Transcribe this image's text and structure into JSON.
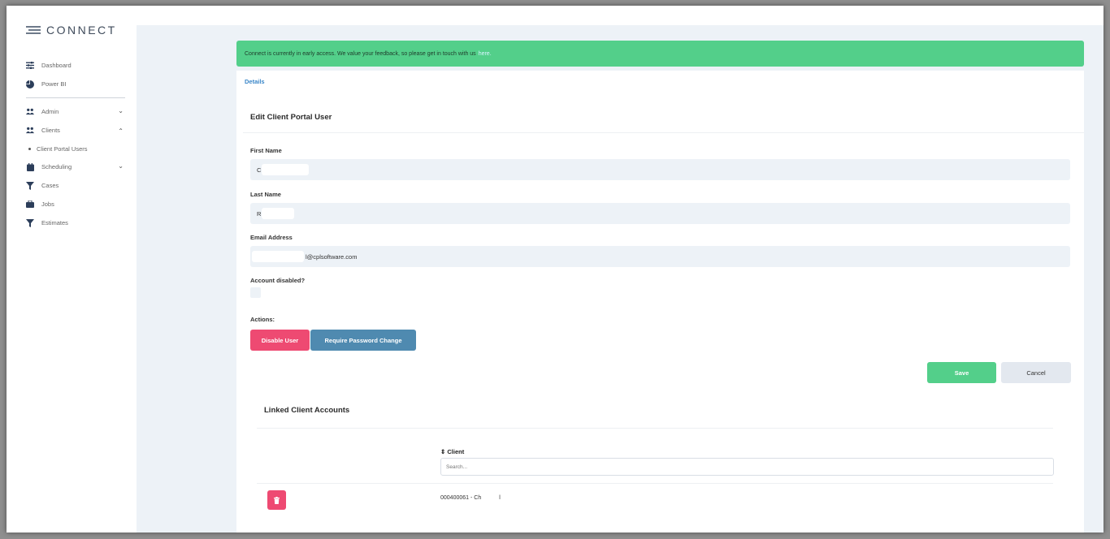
{
  "app": {
    "logo_text": "CONNECT"
  },
  "sidebar": {
    "items": [
      {
        "label": "Dashboard",
        "icon": "sliders-icon"
      },
      {
        "label": "Power BI",
        "icon": "pie-chart-icon"
      },
      {
        "label": "Admin",
        "icon": "users-icon",
        "expanded": false
      },
      {
        "label": "Clients",
        "icon": "users-icon",
        "expanded": true
      },
      {
        "label": "Client Portal Users",
        "sub": true
      },
      {
        "label": "Scheduling",
        "icon": "calendar-icon",
        "expanded": false
      },
      {
        "label": "Cases",
        "icon": "filter-icon"
      },
      {
        "label": "Jobs",
        "icon": "briefcase-icon"
      },
      {
        "label": "Estimates",
        "icon": "filter-icon"
      }
    ]
  },
  "alert": {
    "text": "Connect is currently in early access. We value your feedback, so please get in touch with us",
    "link": "here.",
    "color": "#53cf8a"
  },
  "tabs": {
    "details": "Details"
  },
  "form": {
    "title": "Edit Client Portal User",
    "first_name": {
      "label": "First Name",
      "value": "C"
    },
    "last_name": {
      "label": "Last Name",
      "value": "R"
    },
    "email": {
      "label": "Email Address",
      "value": "l@cplsoftware.com"
    },
    "account_disabled": {
      "label": "Account disabled?",
      "checked": false
    },
    "actions_label": "Actions:",
    "disable_user": "Disable User",
    "require_password": "Require Password Change",
    "save": "Save",
    "cancel": "Cancel"
  },
  "linked": {
    "title": "Linked Client Accounts",
    "column_header": "Client",
    "sort_icon": "⇕",
    "search_placeholder": "Search...",
    "rows": [
      {
        "client": "000400061 - Ch",
        "client_suffix": "l"
      }
    ]
  },
  "colors": {
    "accent_green": "#53cf8a",
    "danger": "#ee4a72",
    "info": "#4f8ab0",
    "link": "#3a86c8"
  }
}
